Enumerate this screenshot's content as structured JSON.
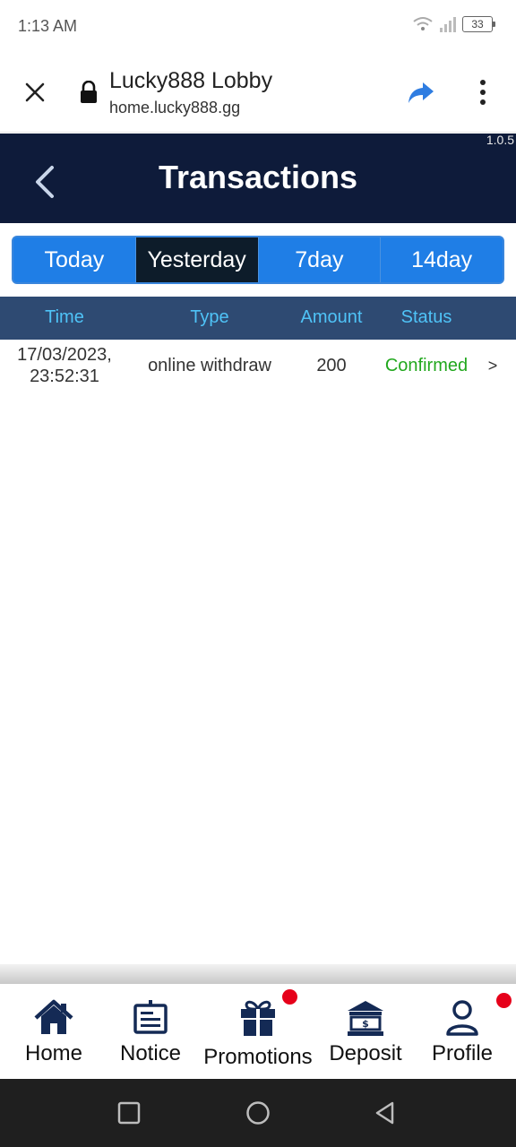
{
  "status_bar": {
    "time": "1:13 AM",
    "battery": "33"
  },
  "browser": {
    "title": "Lucky888 Lobby",
    "url": "home.lucky888.gg"
  },
  "app_header": {
    "version": "1.0.5",
    "title": "Transactions"
  },
  "tabs": [
    {
      "label": "Today",
      "active": false
    },
    {
      "label": "Yesterday",
      "active": true
    },
    {
      "label": "7day",
      "active": false
    },
    {
      "label": "14day",
      "active": false
    }
  ],
  "table": {
    "headers": {
      "time": "Time",
      "type": "Type",
      "amount": "Amount",
      "status": "Status"
    },
    "rows": [
      {
        "time_date": "17/03/2023,",
        "time_clock": "23:52:31",
        "type": "online withdraw",
        "amount": "200",
        "status": "Confirmed",
        "chevron": ">"
      }
    ]
  },
  "bottom_nav": [
    {
      "label": "Home",
      "icon": "home-icon",
      "badge": false
    },
    {
      "label": "Notice",
      "icon": "notice-icon",
      "badge": false
    },
    {
      "label": "Promotions",
      "icon": "gift-icon",
      "badge": true
    },
    {
      "label": "Deposit",
      "icon": "bank-icon",
      "badge": false
    },
    {
      "label": "Profile",
      "icon": "user-icon",
      "badge": true
    }
  ],
  "colors": {
    "header_bg": "#0e1b3a",
    "tab_blue": "#1f7ee6",
    "tab_active": "#0d1c2a",
    "table_header_bg": "#2e4a72",
    "table_header_text": "#4fc3f7",
    "status_confirmed": "#22a81e",
    "badge_red": "#e6001a"
  }
}
